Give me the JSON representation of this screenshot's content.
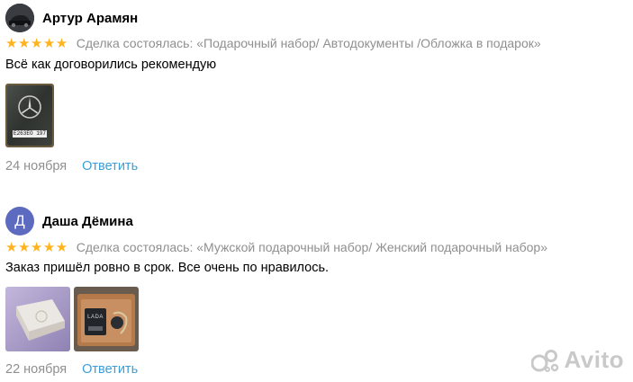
{
  "reviews": [
    {
      "author": "Артур Арамян",
      "stars": "★★★★★",
      "rating": 5,
      "deal": "Сделка состоялась: «Подарочный набор/ Автодокументы /Обложка в подарок»",
      "text": "Всё как договорились рекомендую",
      "date": "24 ноября",
      "reply_label": "Ответить",
      "photo_plate": "Е263ЕО 197"
    },
    {
      "author": "Даша Дёмина",
      "avatar_letter": "Д",
      "stars": "★★★★★",
      "rating": 5,
      "deal": "Сделка состоялась: «Мужской подарочный набор/ Женский подарочный набор»",
      "text": "Заказ пришёл ровно в срок. Все очень по нравилось.",
      "date": "22 ноября",
      "reply_label": "Ответить",
      "photo_label": "LADA"
    }
  ],
  "watermark": "Avito",
  "colors": {
    "star": "#ffb320",
    "link": "#3c9ed8",
    "muted": "#8f8f8f",
    "avatar_letter_bg": "#5c6bc0",
    "watermark": "#c9c9c9"
  }
}
